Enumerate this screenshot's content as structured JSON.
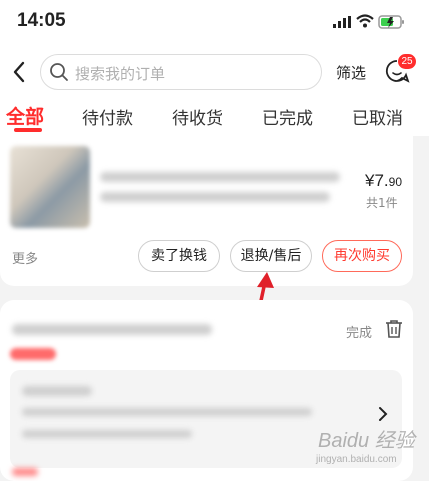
{
  "status_bar": {
    "time": "14:05"
  },
  "header": {
    "search_placeholder": "搜索我的订单",
    "filter_label": "筛选",
    "message_badge": "25"
  },
  "tabs": [
    {
      "label": "全部",
      "active": true
    },
    {
      "label": "待付款"
    },
    {
      "label": "待收货"
    },
    {
      "label": "已完成"
    },
    {
      "label": "已取消"
    }
  ],
  "order1": {
    "price_main": "¥7.",
    "price_decimal": "90",
    "quantity": "共1件",
    "more_label": "更多",
    "buttons": {
      "resell": "卖了换钱",
      "return": "退换/售后",
      "rebuy": "再次购买"
    }
  },
  "order2": {
    "status": "完成"
  },
  "watermark": {
    "main": "Baidu 经验",
    "sub": "jingyan.baidu.com"
  },
  "colors": {
    "accent": "#ff2d2d",
    "arrow": "#e0202a"
  }
}
